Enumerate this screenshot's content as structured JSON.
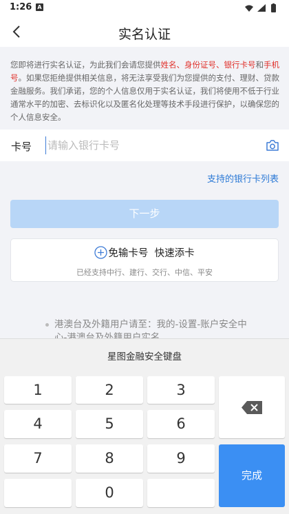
{
  "status_bar": {
    "time": "1:26",
    "notification_badge": "A"
  },
  "nav": {
    "title": "实名认证"
  },
  "notice": {
    "intro": "您即将进行实名认证，为此我们会请您提供",
    "field_name": "姓名",
    "sep1": "、",
    "field_id": "身份证号",
    "sep2": "、",
    "field_card": "银行卡号",
    "conj": "和",
    "field_phone": "手机号",
    "body": "。如果您拒绝提供相关信息，将无法享受我们为您提供的支付、理财、贷款金融服务。我们承诺，您的个人信息仅用于实名认证，我们将使用不低于行业通常水平的加密、去标识化以及匿名化处理等技术手段进行保护，以确保您的个人信息安全。"
  },
  "card_field": {
    "label": "卡号",
    "placeholder": "请输入银行卡号",
    "value": ""
  },
  "support_link": "支持的银行卡列表",
  "next_button": "下一步",
  "quick_add": {
    "title_main": "免输卡号",
    "title_extra": "快速添卡",
    "subtitle": "已经支持中行、建行、交行、中信、平安"
  },
  "foreign_note": "港澳台及外籍用户请至：我的-设置-账户安全中心-港澳台及外籍用户实名",
  "keyboard": {
    "title": "星图金融安全键盘",
    "keys": [
      "1",
      "2",
      "3",
      "4",
      "5",
      "6",
      "7",
      "8",
      "9",
      "0"
    ],
    "done_label": "完成"
  },
  "colors": {
    "accent": "#3b8ff3",
    "link": "#2d7ad6",
    "highlight": "#e0312b",
    "disabled_button": "#b8d6f7"
  }
}
